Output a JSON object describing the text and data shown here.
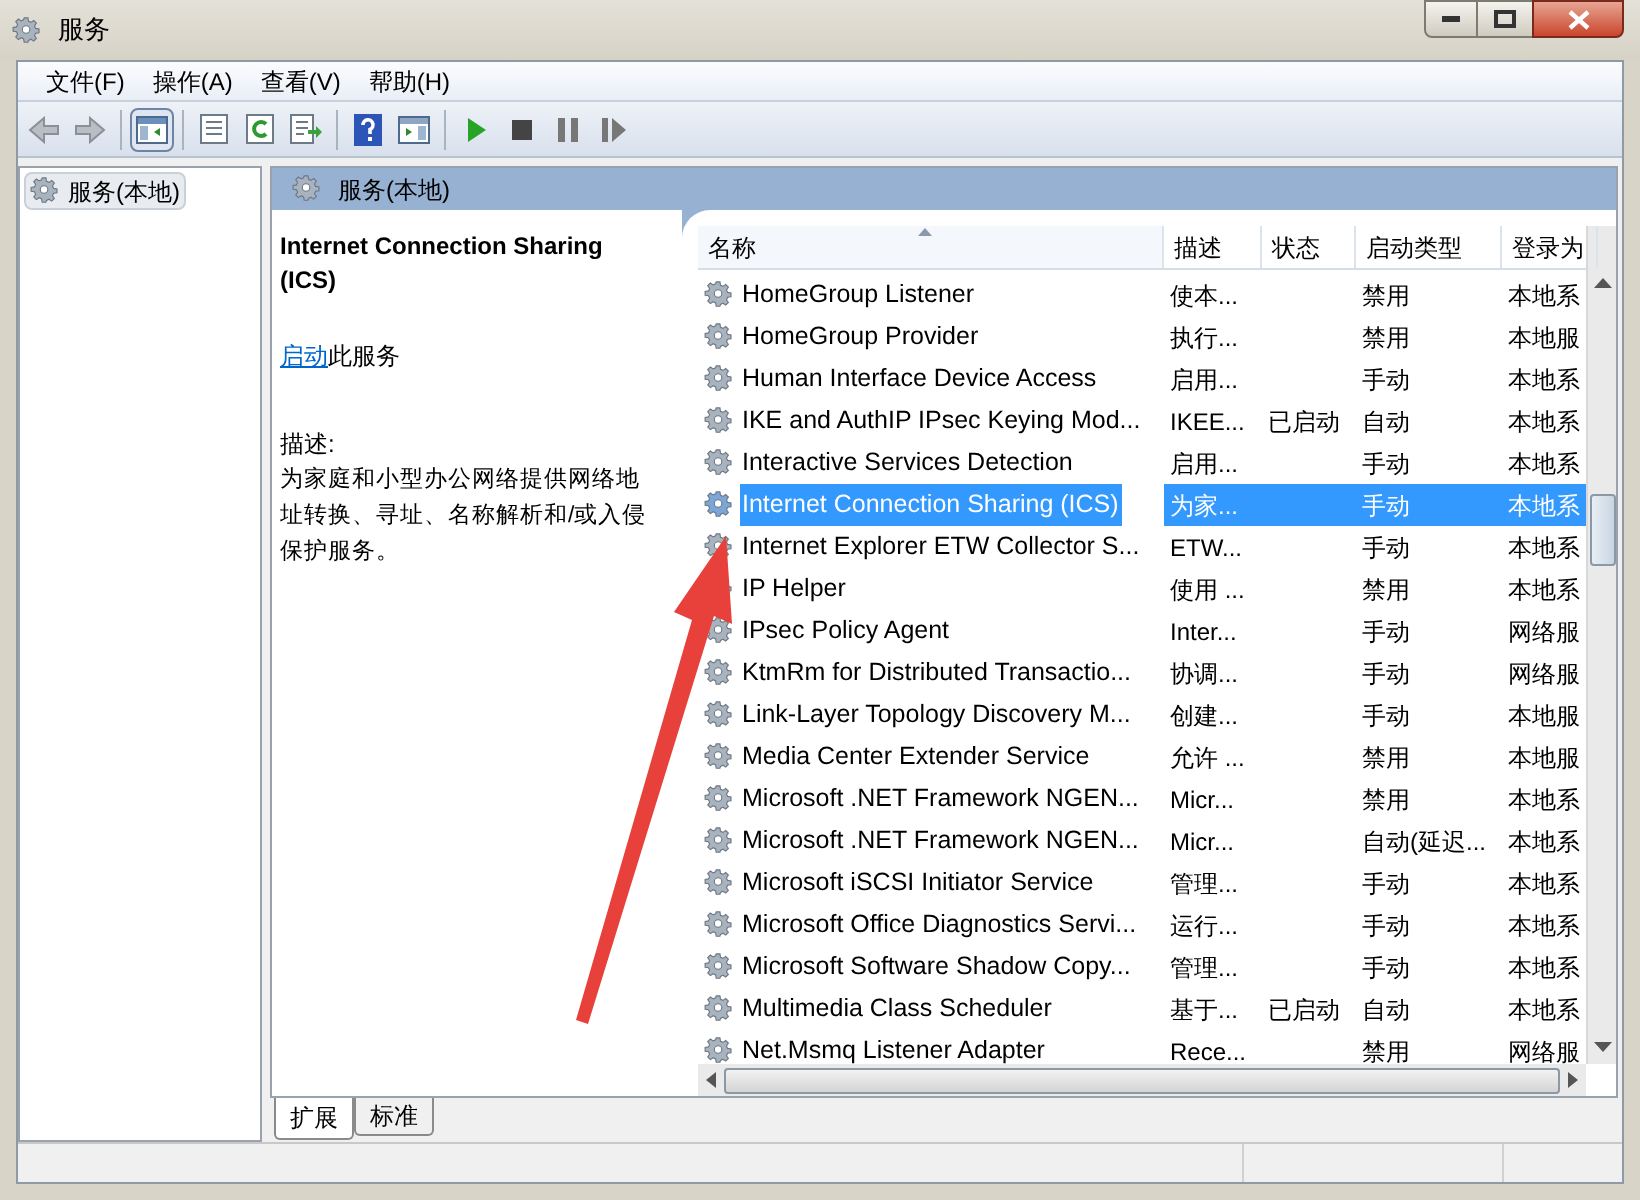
{
  "window": {
    "title": "服务"
  },
  "menu": [
    "文件(F)",
    "操作(A)",
    "查看(V)",
    "帮助(H)"
  ],
  "toolbar": {
    "console_tree_on": true
  },
  "tree": [
    {
      "label": "服务(本地)",
      "selected": true
    }
  ],
  "panel": {
    "title": "服务(本地)"
  },
  "detail": {
    "title": "Internet Connection Sharing (ICS)",
    "link": "启动",
    "link_suffix": "此服务",
    "description_label": "描述:",
    "description": "为家庭和小型办公网络提供网络地址转换、寻址、名称解析和/或入侵保护服务。"
  },
  "table": {
    "columns": [
      "名称",
      "描述",
      "状态",
      "启动类型",
      "登录为"
    ],
    "rows": [
      {
        "cells": [
          "HomeGroup Listener",
          "使本...",
          "",
          "禁用",
          "本地系"
        ],
        "selected": false
      },
      {
        "cells": [
          "HomeGroup Provider",
          "执行...",
          "",
          "禁用",
          "本地服"
        ],
        "selected": false
      },
      {
        "cells": [
          "Human Interface Device Access",
          "启用...",
          "",
          "手动",
          "本地系"
        ],
        "selected": false
      },
      {
        "cells": [
          "IKE and AuthIP IPsec Keying Mod...",
          "IKEE...",
          "已启动",
          "自动",
          "本地系"
        ],
        "selected": false
      },
      {
        "cells": [
          "Interactive Services Detection",
          "启用...",
          "",
          "手动",
          "本地系"
        ],
        "selected": false
      },
      {
        "cells": [
          "Internet Connection Sharing (ICS)",
          "为家...",
          "",
          "手动",
          "本地系"
        ],
        "selected": true
      },
      {
        "cells": [
          "Internet Explorer ETW Collector S...",
          "ETW...",
          "",
          "手动",
          "本地系"
        ],
        "selected": false
      },
      {
        "cells": [
          "IP Helper",
          "使用 ...",
          "",
          "禁用",
          "本地系"
        ],
        "selected": false
      },
      {
        "cells": [
          "IPsec Policy Agent",
          "Inter...",
          "",
          "手动",
          "网络服"
        ],
        "selected": false
      },
      {
        "cells": [
          "KtmRm for Distributed Transactio...",
          "协调...",
          "",
          "手动",
          "网络服"
        ],
        "selected": false
      },
      {
        "cells": [
          "Link-Layer Topology Discovery M...",
          "创建...",
          "",
          "手动",
          "本地服"
        ],
        "selected": false
      },
      {
        "cells": [
          "Media Center Extender Service",
          "允许 ...",
          "",
          "禁用",
          "本地服"
        ],
        "selected": false
      },
      {
        "cells": [
          "Microsoft .NET Framework NGEN...",
          "Micr...",
          "",
          "禁用",
          "本地系"
        ],
        "selected": false
      },
      {
        "cells": [
          "Microsoft .NET Framework NGEN...",
          "Micr...",
          "",
          "自动(延迟...",
          "本地系"
        ],
        "selected": false
      },
      {
        "cells": [
          "Microsoft iSCSI Initiator Service",
          "管理...",
          "",
          "手动",
          "本地系"
        ],
        "selected": false
      },
      {
        "cells": [
          "Microsoft Office Diagnostics Servi...",
          "运行...",
          "",
          "手动",
          "本地系"
        ],
        "selected": false
      },
      {
        "cells": [
          "Microsoft Software Shadow Copy...",
          "管理...",
          "",
          "手动",
          "本地系"
        ],
        "selected": false
      },
      {
        "cells": [
          "Multimedia Class Scheduler",
          "基于...",
          "已启动",
          "自动",
          "本地系"
        ],
        "selected": false
      },
      {
        "cells": [
          "Net.Msmq Listener Adapter",
          "Rece...",
          "",
          "禁用",
          "网络服"
        ],
        "selected": false
      }
    ]
  },
  "tabs": [
    {
      "label": "扩展",
      "selected": true
    },
    {
      "label": "标准",
      "selected": false
    }
  ]
}
